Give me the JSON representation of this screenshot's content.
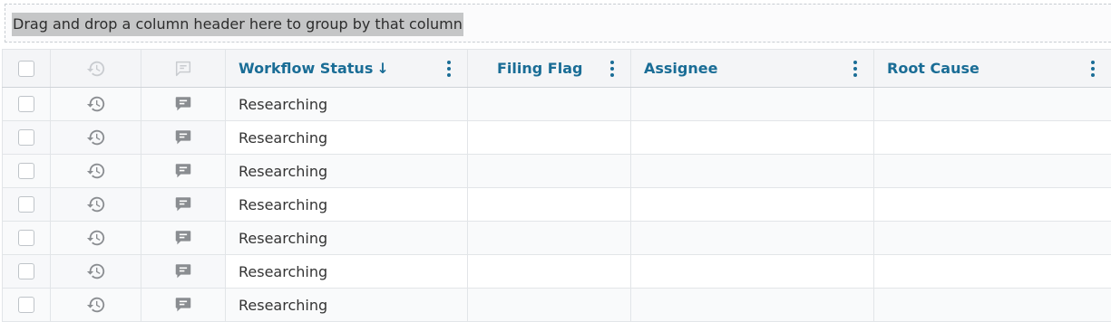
{
  "group_panel": {
    "text": "Drag and drop a column header here to group by that column"
  },
  "columns": {
    "select": {
      "icon": "checkbox"
    },
    "history": {
      "icon": "history-icon"
    },
    "comments": {
      "icon": "comment-icon"
    },
    "workflow_status": {
      "label": "Workflow Status",
      "sort": "↓"
    },
    "filing_flag": {
      "label": "Filing Flag"
    },
    "assignee": {
      "label": "Assignee"
    },
    "root_cause": {
      "label": "Root Cause"
    }
  },
  "rows": [
    {
      "workflow_status": "Researching",
      "filing_flag": "",
      "assignee": "",
      "root_cause": ""
    },
    {
      "workflow_status": "Researching",
      "filing_flag": "",
      "assignee": "",
      "root_cause": ""
    },
    {
      "workflow_status": "Researching",
      "filing_flag": "",
      "assignee": "",
      "root_cause": ""
    },
    {
      "workflow_status": "Researching",
      "filing_flag": "",
      "assignee": "",
      "root_cause": ""
    },
    {
      "workflow_status": "Researching",
      "filing_flag": "",
      "assignee": "",
      "root_cause": ""
    },
    {
      "workflow_status": "Researching",
      "filing_flag": "",
      "assignee": "",
      "root_cause": ""
    },
    {
      "workflow_status": "Researching",
      "filing_flag": "",
      "assignee": "",
      "root_cause": ""
    }
  ],
  "colors": {
    "header_text": "#1a6d96",
    "icon_gray": "#8a8d91"
  }
}
